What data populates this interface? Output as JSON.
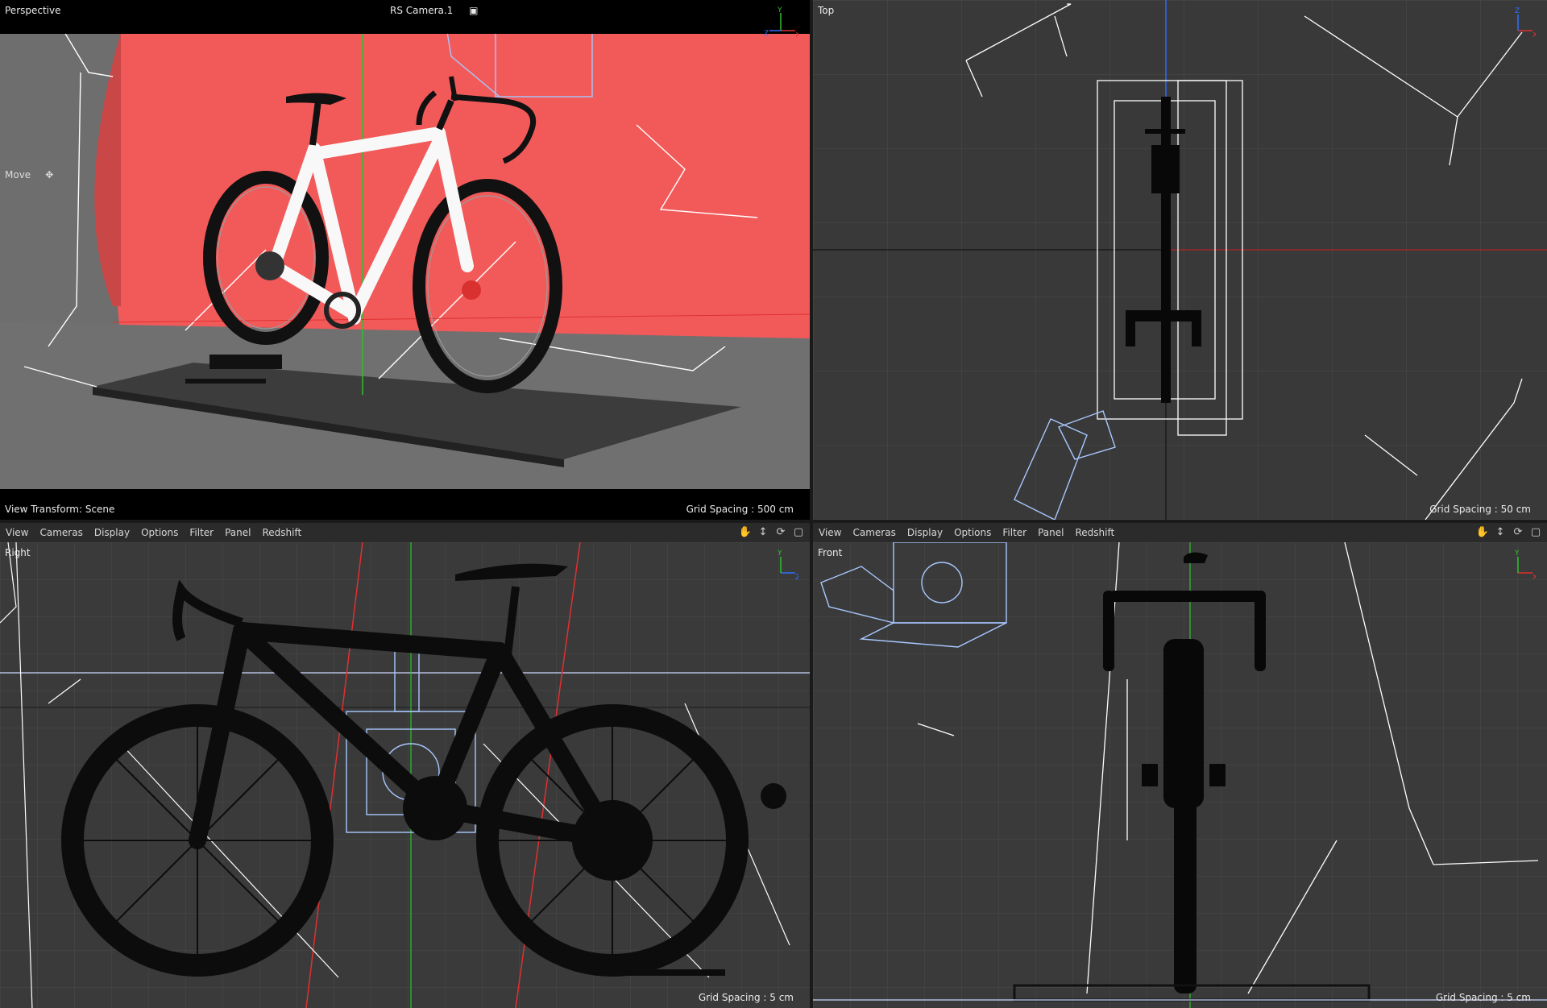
{
  "viewports": {
    "perspective": {
      "title": "Perspective",
      "camera": "RS Camera.1",
      "tool": "Move",
      "view_transform": "View Transform: Scene",
      "grid_spacing": "Grid Spacing : 500 cm"
    },
    "top": {
      "title": "Top",
      "grid_spacing": "Grid Spacing : 50 cm"
    },
    "right": {
      "title": "Right",
      "grid_spacing": "Grid Spacing : 5 cm"
    },
    "front": {
      "title": "Front",
      "grid_spacing": "Grid Spacing : 5 cm"
    }
  },
  "menu": [
    "View",
    "Cameras",
    "Display",
    "Options",
    "Filter",
    "Panel",
    "Redshift"
  ],
  "axis_labels": {
    "x": "X",
    "y": "Y",
    "z": "Z"
  },
  "colors": {
    "background_red": "#f25a5a",
    "wire_light": "#a8c8ff",
    "wire_white": "#ffffff",
    "axis_x": "#e03030",
    "axis_y": "#30c030",
    "axis_z": "#3070ff",
    "grid": "#4a4a4a"
  },
  "icons": [
    "camera-icon",
    "hand-pan-icon",
    "move-arrows-icon",
    "rotate-icon",
    "maximize-icon"
  ]
}
